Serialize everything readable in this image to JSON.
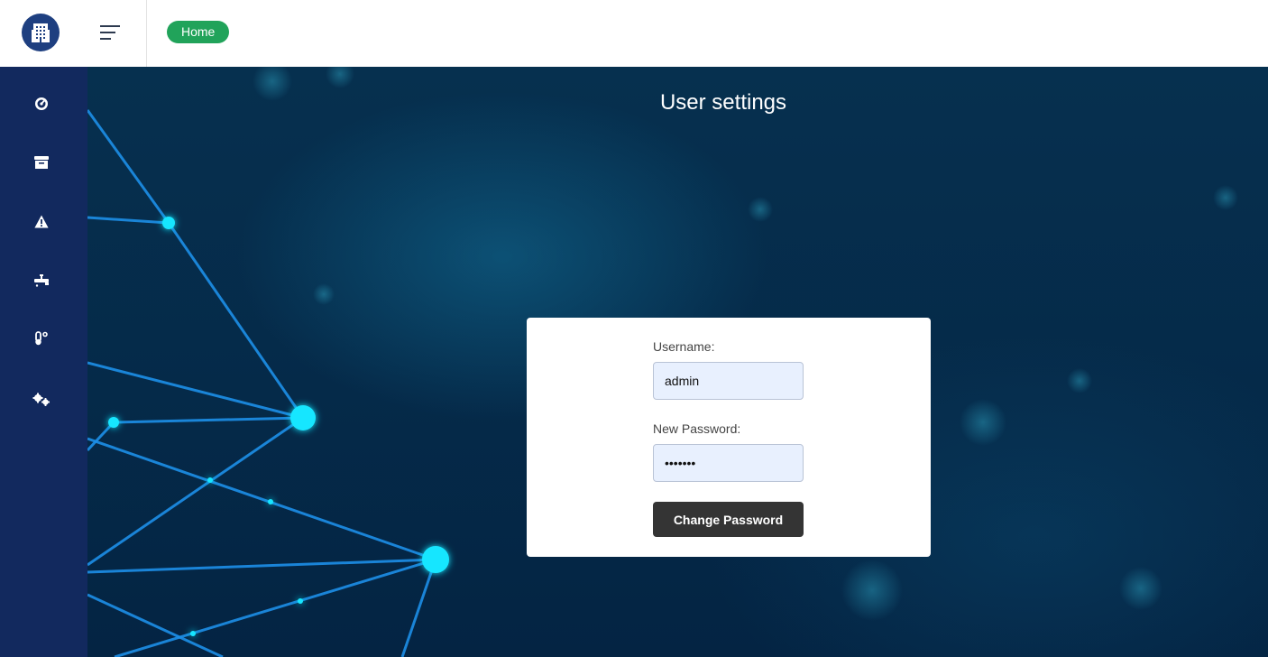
{
  "header": {
    "logo_icon": "office-building-icon",
    "menu_icon": "menu-icon",
    "breadcrumb_home": "Home",
    "pill_color": "#21a35a"
  },
  "sidebar": {
    "background": "#12295e",
    "items": [
      {
        "icon": "dashboard-gauge-icon"
      },
      {
        "icon": "archive-box-icon"
      },
      {
        "icon": "warning-triangle-icon"
      },
      {
        "icon": "water-faucet-icon"
      },
      {
        "icon": "thermometer-icon"
      },
      {
        "icon": "settings-cogs-icon"
      }
    ]
  },
  "page": {
    "title": "User settings"
  },
  "form": {
    "username_label": "Username:",
    "username_value": "admin",
    "password_label": "New Password:",
    "password_value": "1234567",
    "submit_label": "Change Password",
    "input_background": "#e8f0fe",
    "button_color": "#343434"
  }
}
